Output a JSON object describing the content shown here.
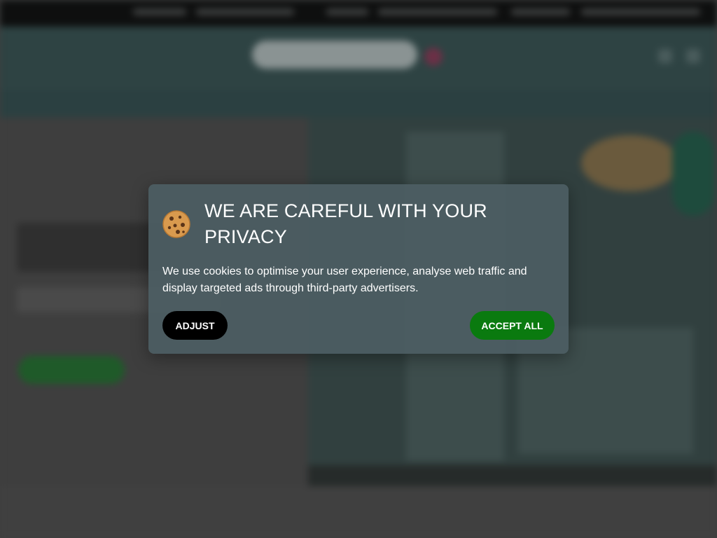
{
  "cookie_dialog": {
    "icon": "cookie-icon",
    "title": "WE ARE CAREFUL WITH YOUR PRIVACY",
    "body": "We use cookies to optimise your user experience, analyse web traffic and display targeted ads through third-party advertisers.",
    "adjust_label": "ADJUST",
    "accept_label": "ACCEPT ALL",
    "colors": {
      "panel": "#4c5e63",
      "adjust_button": "#000000",
      "accept_button": "#0a7a0f"
    }
  },
  "background": {
    "blurred": true,
    "colors": {
      "top_bar": "#0e0f0f",
      "header": "#2e4343",
      "hero_left": "#3e3e3e",
      "hero_cta": "#1f5a29"
    }
  }
}
